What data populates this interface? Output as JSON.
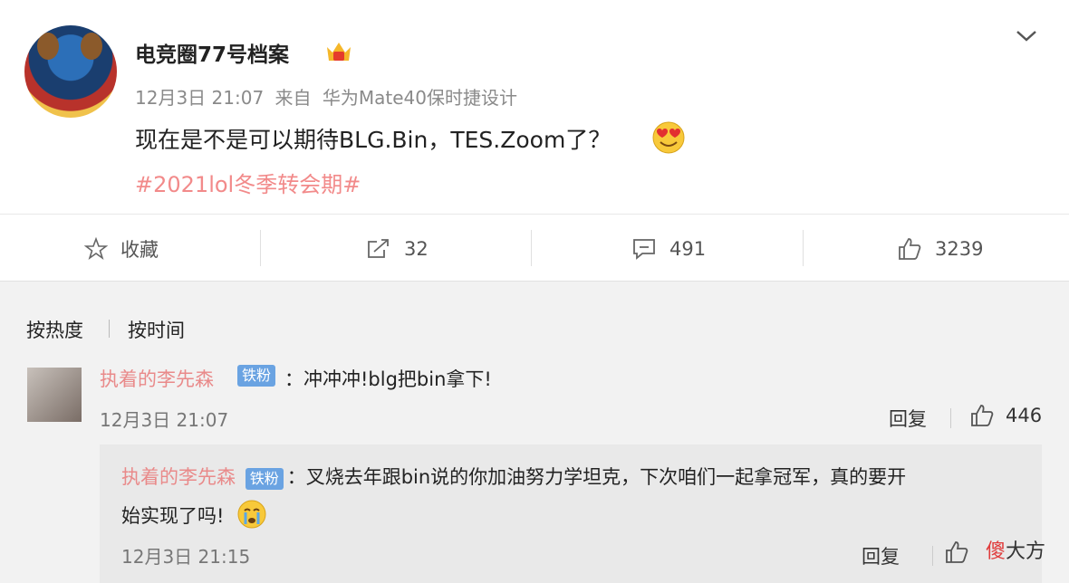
{
  "post": {
    "username": "电竞圈77号档案",
    "date": "12月3日 21:07",
    "source_prefix": "来自",
    "source": "华为Mate40保时捷设计",
    "text": "现在是不是可以期待BLG.Bin，TES.Zoom了？",
    "hashtag": "#2021lol冬季转会期#"
  },
  "actions": {
    "favorite_label": "收藏",
    "repost_count": "32",
    "comment_count": "491",
    "like_count": "3239"
  },
  "sort": {
    "by_hot": "按热度",
    "by_time": "按时间"
  },
  "comment": {
    "author": "执着的李先森",
    "badge": "铁粉",
    "text": "：冲冲冲!blg把bin拿下!",
    "time": "12月3日 21:07",
    "reply_label": "回复",
    "likes": "446"
  },
  "sub_comment": {
    "author": "执着的李先森",
    "badge": "铁粉",
    "text_line1": "：叉烧去年跟bin说的你加油努力学坦克，下次咱们一起拿冠军，真的要开",
    "text_line2": "始实现了吗!",
    "time": "12月3日 21:15",
    "reply_label": "回复"
  },
  "watermark": {
    "part1": "傻",
    "part2": "大方"
  },
  "colors": {
    "hashtag": "#f28a8a",
    "author": "#e98a8a",
    "badge": "#6aa3e2"
  }
}
